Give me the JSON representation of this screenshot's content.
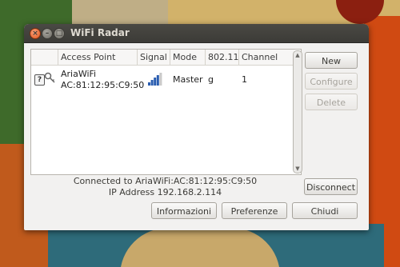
{
  "window": {
    "title": "WiFi Radar"
  },
  "table": {
    "columns": [
      "Access Point",
      "Signal",
      "Mode",
      "802.11",
      "Channel"
    ],
    "rows": [
      {
        "essid": "AriaWiFi",
        "bssid": "AC:81:12:95:C9:50",
        "signal_level": 0.8,
        "mode": "Master",
        "protocol": "g",
        "channel": "1"
      }
    ]
  },
  "buttons": {
    "new": "New",
    "configure": "Configure",
    "delete": "Delete",
    "disconnect": "Disconnect",
    "info": "Informazioni",
    "prefs": "Preferenze",
    "close": "Chiudi"
  },
  "status": {
    "connected": "Connected to AriaWiFi:AC:81:12:95:C9:50",
    "ip": "IP Address 192.168.2.114"
  },
  "colors": {
    "signal": "#2a5db0",
    "titlebar": "#3c3b37",
    "close_button": "#e0561b"
  }
}
